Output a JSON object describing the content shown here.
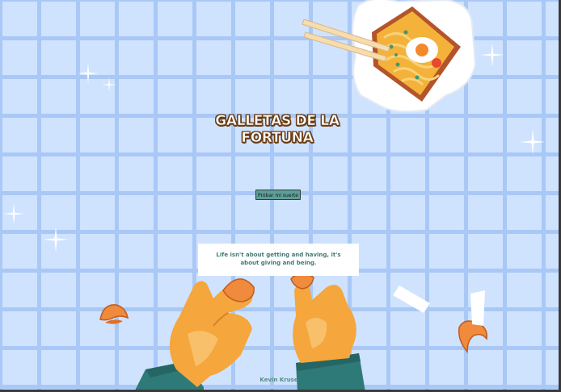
{
  "title": "GALLETAS DE LA FORTUNA",
  "button": {
    "label": "Probar mi suerte"
  },
  "fortune": {
    "text": "Life isn't about getting and having, it's about giving and being."
  },
  "footer": {
    "author": "Kevin Kruse"
  },
  "colors": {
    "background": "#cfe3ff",
    "grid_lines": "#a9c8f5",
    "button": "#5f9e98",
    "fortune_text": "#3f7a76",
    "title_outline": "#6b3e16",
    "cookie": "#f08a3c",
    "skin": "#f5a63c",
    "sleeve": "#2e7a78"
  },
  "icons": [
    "noodle-box-illustration",
    "chopsticks-icon",
    "fortune-cookie-icon",
    "hand-illustration",
    "sparkle-icon",
    "paper-strip-icon"
  ]
}
